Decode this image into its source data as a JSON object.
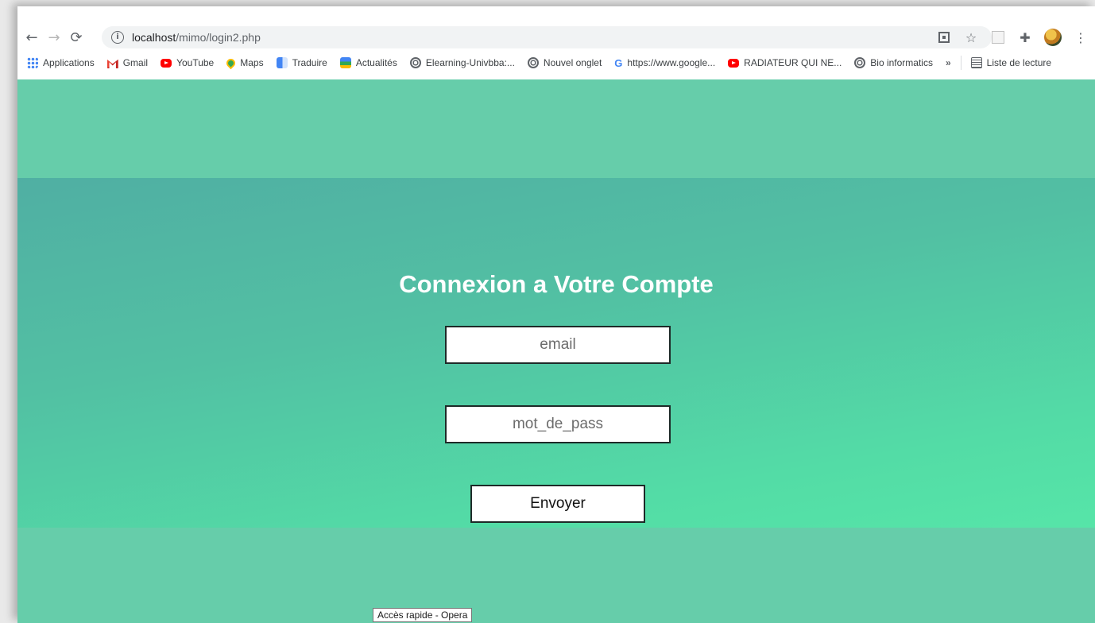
{
  "browser": {
    "url_host": "localhost",
    "url_path": "/mimo/login2.php",
    "bookmarks": [
      {
        "label": "Applications",
        "icon": "apps-grid-icon"
      },
      {
        "label": "Gmail",
        "icon": "gmail-icon"
      },
      {
        "label": "YouTube",
        "icon": "youtube-icon"
      },
      {
        "label": "Maps",
        "icon": "maps-icon"
      },
      {
        "label": "Traduire",
        "icon": "translate-icon"
      },
      {
        "label": "Actualités",
        "icon": "news-icon"
      },
      {
        "label": "Elearning-Univbba:...",
        "icon": "globe-icon"
      },
      {
        "label": "Nouvel onglet",
        "icon": "globe-icon"
      },
      {
        "label": "https://www.google...",
        "icon": "google-icon"
      },
      {
        "label": "RADIATEUR QUI NE...",
        "icon": "youtube-icon"
      },
      {
        "label": "Bio informatics",
        "icon": "globe-icon"
      }
    ],
    "overflow_label": "»",
    "reading_list_label": "Liste de lecture"
  },
  "page": {
    "title": "Connexion a Votre Compte",
    "email_placeholder": "email",
    "password_placeholder": "mot_de_pass",
    "submit_label": "Envoyer",
    "colors": {
      "background": "#66cdaa",
      "hero_start": "#50afa3",
      "hero_end": "#56e5a8",
      "title": "#ffffff"
    }
  },
  "tooltip": "Accès rapide - Opera"
}
